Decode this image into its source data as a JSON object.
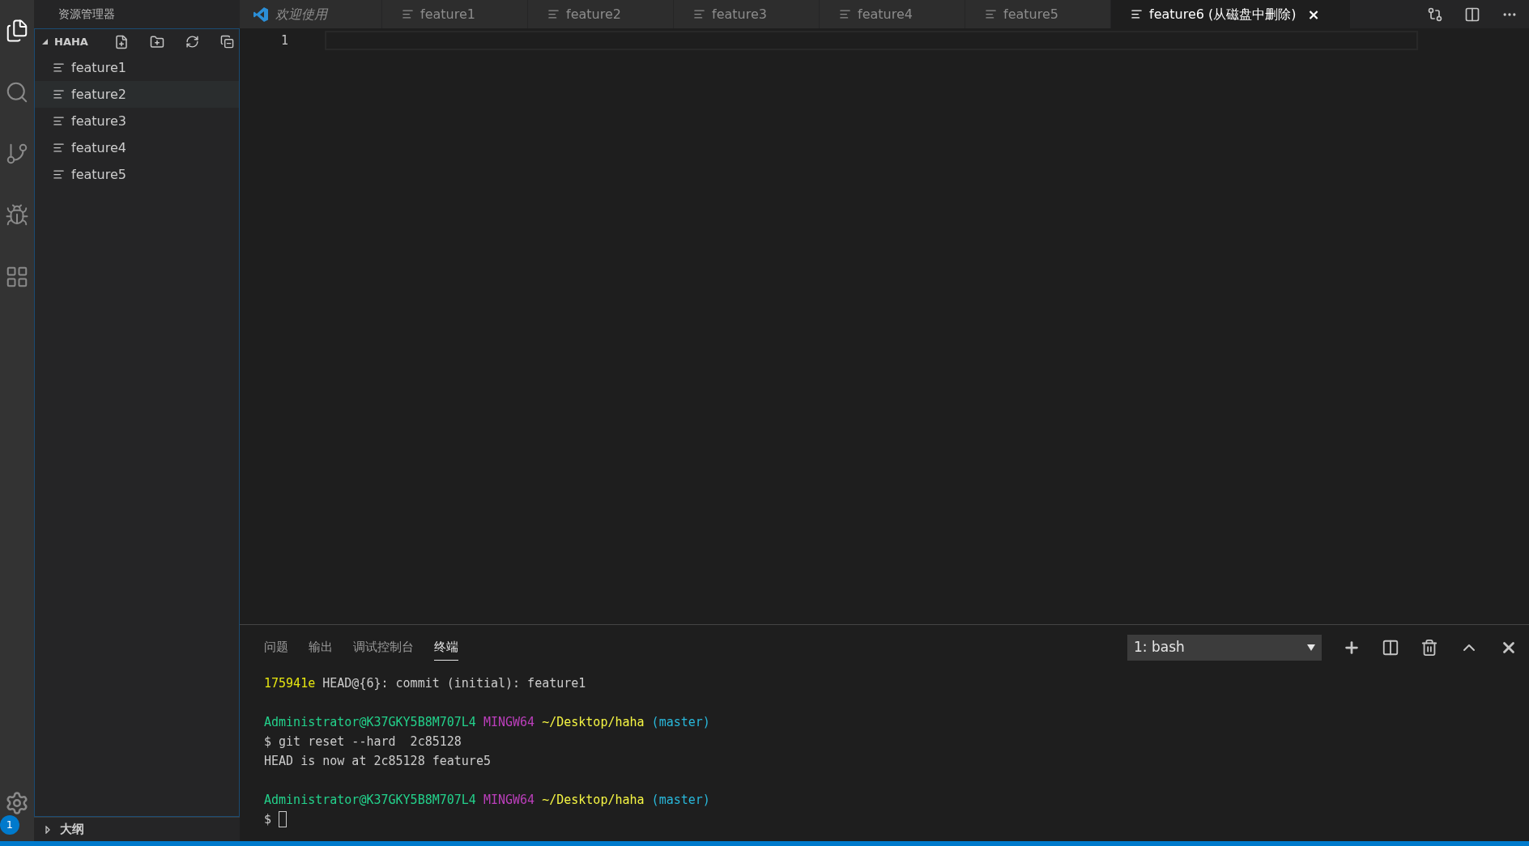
{
  "activity_bar": {
    "items": [
      {
        "kind": "files",
        "selected": true
      },
      {
        "kind": "search",
        "selected": false
      },
      {
        "kind": "git",
        "selected": false
      },
      {
        "kind": "debug",
        "selected": false
      },
      {
        "kind": "extensions",
        "selected": false
      }
    ],
    "settings_badge": "1"
  },
  "sidebar": {
    "title": "资源管理器",
    "section": {
      "title": "HAHA",
      "expanded": true,
      "items": [
        {
          "label": "feature1",
          "selected": false
        },
        {
          "label": "feature2",
          "selected": true
        },
        {
          "label": "feature3",
          "selected": false
        },
        {
          "label": "feature4",
          "selected": false
        },
        {
          "label": "feature5",
          "selected": false
        }
      ]
    },
    "outline": {
      "title": "大纲",
      "expanded": false
    }
  },
  "tabs": [
    {
      "kind": "preview",
      "label": "欢迎使用",
      "selected": false
    },
    {
      "kind": "file",
      "label": "feature1",
      "selected": false
    },
    {
      "kind": "file",
      "label": "feature2",
      "selected": false
    },
    {
      "kind": "file",
      "label": "feature3",
      "selected": false
    },
    {
      "kind": "file",
      "label": "feature4",
      "selected": false
    },
    {
      "kind": "file",
      "label": "feature5",
      "selected": false
    },
    {
      "kind": "file",
      "label": "feature6 (从磁盘中删除)",
      "selected": true,
      "close": "×"
    }
  ],
  "editor": {
    "line_numbers": [
      "1"
    ]
  },
  "panel": {
    "tabs": [
      {
        "label": "问题",
        "selected": false
      },
      {
        "label": "输出",
        "selected": false
      },
      {
        "label": "调试控制台",
        "selected": false
      },
      {
        "label": "终端",
        "selected": true
      }
    ],
    "terminal_select": "1: bash",
    "terminal": {
      "blocks": [
        {
          "lines": [
            {
              "segments": [
                {
                  "kind": "hash",
                  "text": "175941e"
                },
                {
                  "kind": "plain",
                  "text": "HEAD@{6}: commit (initial): feature1"
                }
              ]
            }
          ]
        },
        {
          "lines": [
            {
              "segments": [
                {
                  "kind": "user",
                  "text": "Administrator@K37GKY5B8M707L4"
                },
                {
                  "kind": "host",
                  "text": "MINGW64"
                },
                {
                  "kind": "path",
                  "text": "~/Desktop/haha"
                },
                {
                  "kind": "branch",
                  "text": "(master)"
                }
              ]
            },
            {
              "segments": [
                {
                  "kind": "plain",
                  "text": "$ git reset --hard  2c85128"
                }
              ]
            },
            {
              "segments": [
                {
                  "kind": "plain",
                  "text": "HEAD is now at 2c85128 feature5"
                }
              ]
            }
          ]
        },
        {
          "lines": [
            {
              "segments": [
                {
                  "kind": "user",
                  "text": "Administrator@K37GKY5B8M707L4"
                },
                {
                  "kind": "host",
                  "text": "MINGW64"
                },
                {
                  "kind": "path",
                  "text": "~/Desktop/haha"
                },
                {
                  "kind": "branch",
                  "text": "(master)"
                }
              ]
            },
            {
              "segments": [
                {
                  "kind": "plain",
                  "text": "$"
                }
              ],
              "cursor": true
            }
          ]
        }
      ]
    }
  }
}
